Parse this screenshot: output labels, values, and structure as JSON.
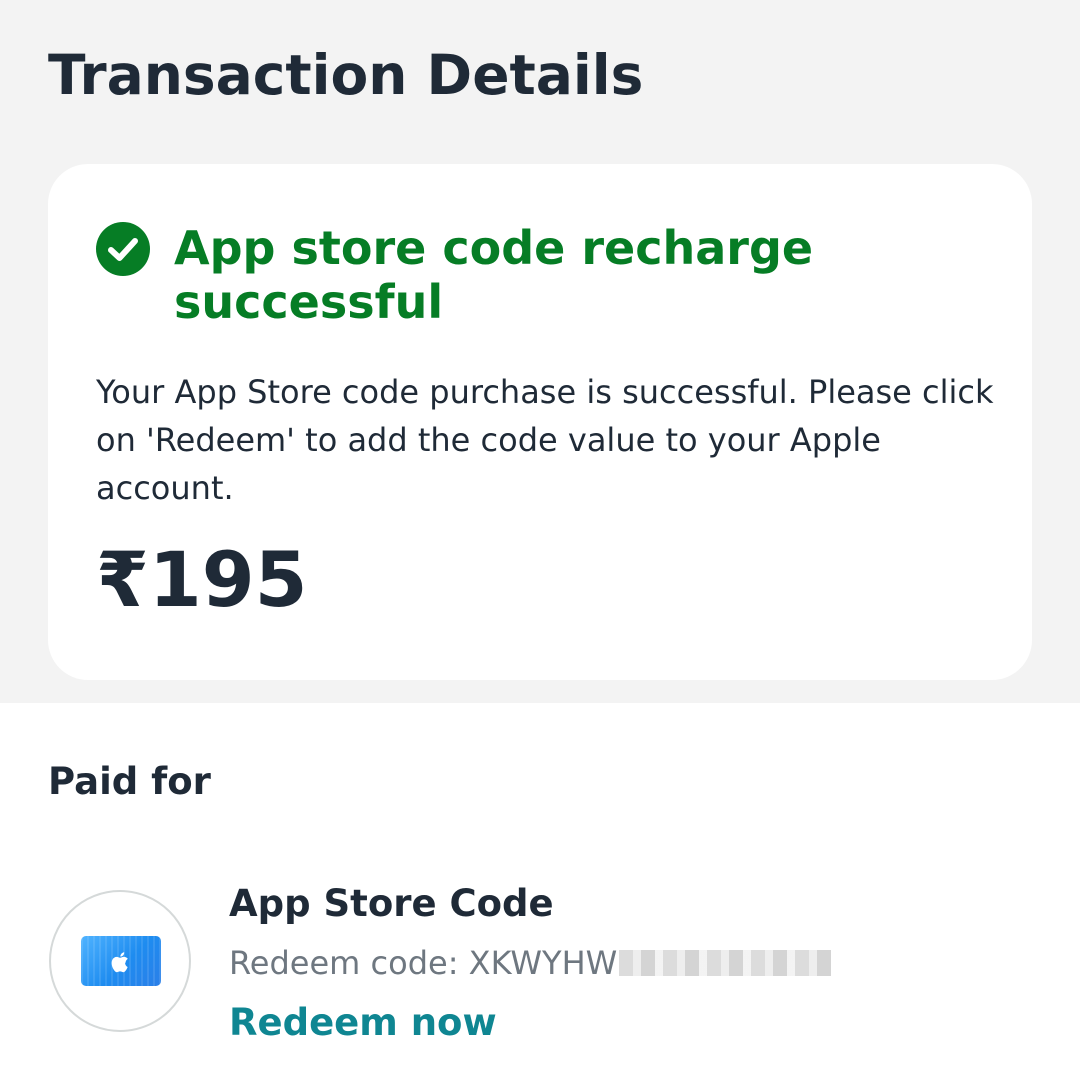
{
  "header": {
    "title": "Transaction Details"
  },
  "status_card": {
    "status_icon": "check-circle-icon",
    "status_color": "#067d25",
    "title": "App store code recharge successful",
    "message": "Your App Store code purchase is successful. Please click on 'Redeem' to add the code value to your Apple account.",
    "amount": "₹195"
  },
  "paid_for": {
    "heading": "Paid for",
    "item": {
      "icon": "apple-gift-card-icon",
      "name": "App Store Code",
      "redeem_code_label": "Redeem code: XKWYHW",
      "redeem_action": "Redeem now",
      "link_color": "#0f8692"
    }
  }
}
